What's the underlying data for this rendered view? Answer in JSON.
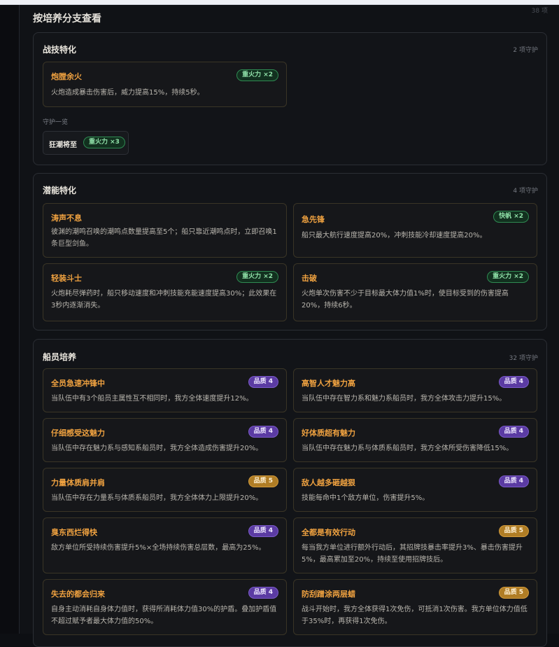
{
  "header": {
    "title": "按培养分支查看",
    "corner_count": "38 项"
  },
  "sections": [
    {
      "title": "战技特化",
      "count": "2 项守护",
      "cards": [
        {
          "title": "炮膛余火",
          "badge": "重火力 ×2",
          "desc": "火炮造成暴击伤害后，威力提高15%，持续5秒。"
        }
      ],
      "guard_label": "守护一览",
      "guard": {
        "name": "狂潮将至",
        "badge": "重火力 ×3"
      }
    },
    {
      "title": "潜能特化",
      "count": "4 项守护",
      "cards": [
        {
          "title": "涛声不息",
          "desc": "彼渊的潮鸣召唤的潮鸣点数量提高至5个；船只靠近潮鸣点时，立即召唤1条巨型剑鱼。"
        },
        {
          "title": "急先锋",
          "badge": "快帆 ×2",
          "desc": "船只最大航行速度提高20%，冲刺技能冷却速度提高20%。"
        },
        {
          "title": "轻装斗士",
          "badge": "重火力 ×2",
          "desc": "火炮耗尽弹药时，船只移动速度和冲刺技能充能速度提高30%；此效果在3秒内逐渐消失。"
        },
        {
          "title": "击破",
          "badge": "重火力 ×2",
          "desc": "火炮单次伤害不少于目标最大体力值1%时，使目标受到的伤害提高20%，持续6秒。"
        }
      ]
    },
    {
      "title": "船员培养",
      "count": "32 项守护",
      "cards": [
        {
          "title": "全员急速冲锋中",
          "badge": "品质 4",
          "desc": "当队伍中有3个船员主属性互不相同时，我方全体速度提升12%。"
        },
        {
          "title": "高智人才魅力高",
          "badge": "品质 4",
          "desc": "当队伍中存在智力系和魅力系船员时，我方全体攻击力提升15%。"
        },
        {
          "title": "仔细感受这魅力",
          "badge": "品质 4",
          "desc": "当队伍中存在魅力系与感知系船员时，我方全体造成伤害提升20%。"
        },
        {
          "title": "好体质超有魅力",
          "badge": "品质 4",
          "desc": "当队伍中存在魅力系与体质系船员时，我方全体所受伤害降低15%。"
        },
        {
          "title": "力量体质肩并肩",
          "badge": "品质 5",
          "desc": "当队伍中存在力量系与体质系船员时，我方全体体力上限提升20%。"
        },
        {
          "title": "敌人越多砸越狠",
          "badge": "品质 4",
          "desc": "技能每命中1个敌方单位，伤害提升5%。"
        },
        {
          "title": "臭东西烂得快",
          "badge": "品质 4",
          "desc": "敌方单位所受持续伤害提升5%×全场持续伤害总层数，最高为25%。"
        },
        {
          "title": "全都是有效行动",
          "badge": "品质 5",
          "desc": "每当我方单位进行额外行动后，其招牌技暴击率提升3%、暴击伤害提升5%，最高累加至20%，持续至使用招牌技后。"
        },
        {
          "title": "失去的都会归来",
          "badge": "品质 4",
          "desc": "自身主动消耗自身体力值时，获得所消耗体力值30%的护盾。叠加护盾值不超过赋予者最大体力值的50%。"
        },
        {
          "title": "防刮蹭涂两层蜡",
          "badge": "品质 5",
          "desc": "战斗开始时，我方全体获得1次免伤，可抵消1次伤害。我方单位体力值低于35%时，再获得1次免伤。"
        }
      ]
    }
  ]
}
